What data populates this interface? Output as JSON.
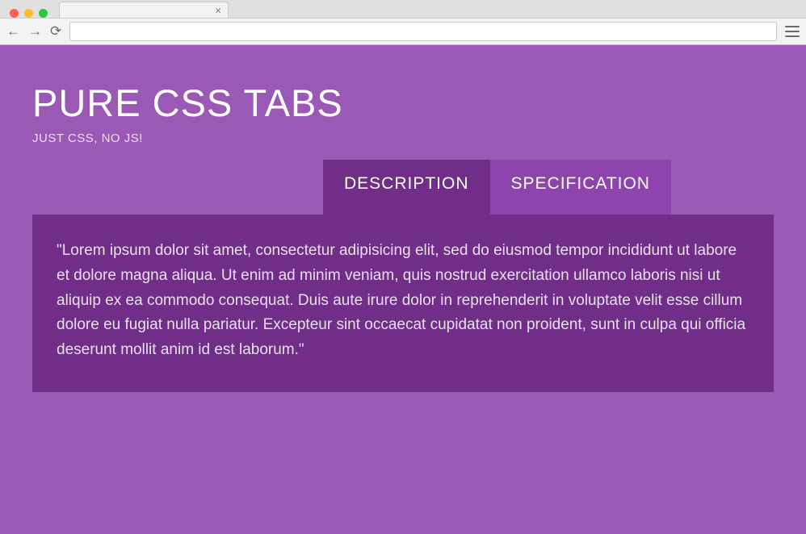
{
  "browser": {
    "tab_close_glyph": "×"
  },
  "page": {
    "title": "PURE CSS TABS",
    "subtitle": "JUST CSS, NO JS!"
  },
  "tabs": [
    {
      "label": "DESCRIPTION",
      "active": true
    },
    {
      "label": "SPECIFICATION",
      "active": false
    }
  ],
  "content": {
    "description": "\"Lorem ipsum dolor sit amet, consectetur adipisicing elit, sed do eiusmod tempor incididunt ut labore et dolore magna aliqua. Ut enim ad minim veniam, quis nostrud exercitation ullamco laboris nisi ut aliquip ex ea commodo consequat. Duis aute irure dolor in reprehenderit in voluptate velit esse cillum dolore eu fugiat nulla pariatur. Excepteur sint occaecat cupidatat non proident, sunt in culpa qui officia deserunt mollit anim id est laborum.\""
  }
}
